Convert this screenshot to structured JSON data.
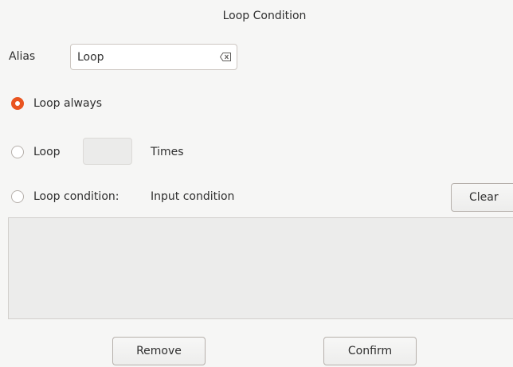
{
  "window": {
    "title": "Loop Condition"
  },
  "alias": {
    "label": "Alias",
    "value": "Loop",
    "clear_icon": "backspace-clear-icon"
  },
  "loop_options": {
    "always_label": "Loop always",
    "always_selected": true,
    "times_label": "Loop",
    "times_selected": false,
    "times_value": "",
    "times_suffix": "Times",
    "condition_label": "Loop condition:",
    "condition_selected": false,
    "condition_hint": "Input condition",
    "condition_text": ""
  },
  "buttons": {
    "clear": "Clear",
    "remove": "Remove",
    "confirm": "Confirm"
  },
  "colors": {
    "accent": "#e95420",
    "background": "#f6f6f5"
  }
}
